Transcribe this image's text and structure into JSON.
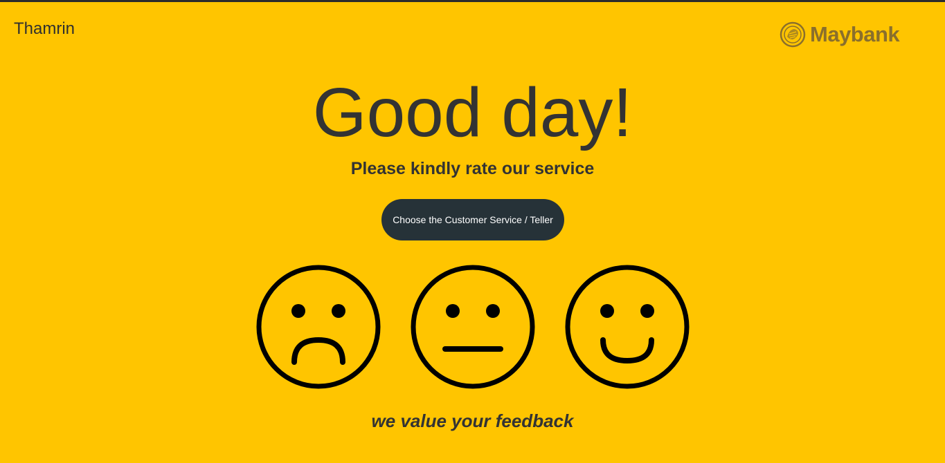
{
  "header": {
    "branch_name": "Thamrin",
    "logo_text": "Maybank",
    "logo_icon": "tiger-emblem-icon"
  },
  "main": {
    "greeting": "Good day!",
    "prompt": "Please kindly rate our service",
    "choose_button_label": "Choose the Customer Service / Teller",
    "ratings": [
      {
        "name": "sad-face-icon"
      },
      {
        "name": "neutral-face-icon"
      },
      {
        "name": "happy-face-icon"
      }
    ],
    "footer": "we value your feedback"
  },
  "colors": {
    "background": "#FFC500",
    "button": "#263238",
    "text": "#333333",
    "logo": "#8a6f2c"
  }
}
